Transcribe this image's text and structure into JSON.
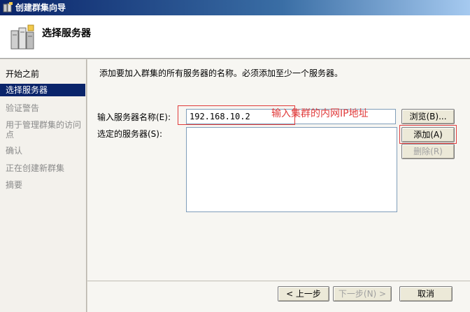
{
  "window": {
    "title": "创建群集向导"
  },
  "header": {
    "title": "选择服务器"
  },
  "sidebar": {
    "items": [
      {
        "label": "开始之前"
      },
      {
        "label": "选择服务器"
      },
      {
        "label": "验证警告"
      },
      {
        "label": "用于管理群集的访问"
      },
      {
        "label": "点"
      },
      {
        "label": "确认"
      },
      {
        "label": "正在创建新群集"
      },
      {
        "label": "摘要"
      }
    ]
  },
  "main": {
    "instruction": "添加要加入群集的所有服务器的名称。必须添加至少一个服务器。",
    "server_name_label": "输入服务器名称(E):",
    "server_name_value": "192.168.10.2",
    "selected_servers_label": "选定的服务器(S):",
    "browse_label": "浏览(B)...",
    "add_label": "添加(A)",
    "remove_label": "删除(R)",
    "annotation": "输入集群的内网IP地址"
  },
  "footer": {
    "prev_label": "< 上一步",
    "next_label": "下一步(N) >",
    "cancel_label": "取消"
  },
  "colors": {
    "annotation": "#e03b3b",
    "selection": "#0a246a"
  }
}
